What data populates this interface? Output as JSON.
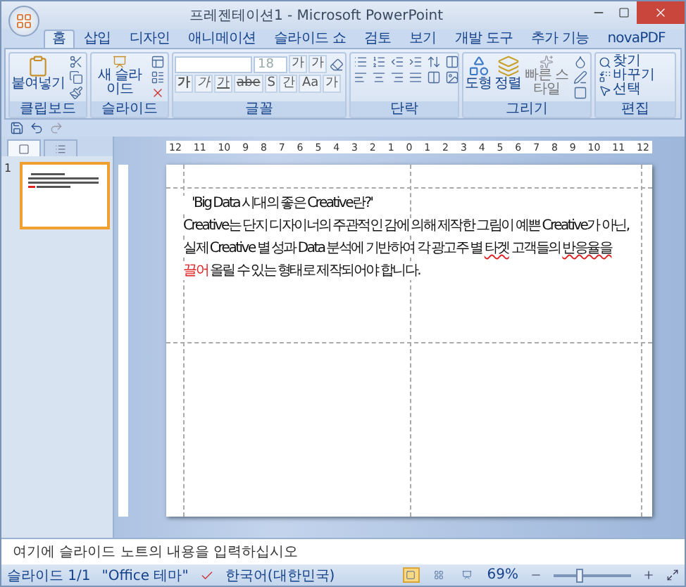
{
  "window": {
    "title": "프레젠테이션1 - Microsoft PowerPoint"
  },
  "tabs": [
    {
      "label": "홈",
      "selected": true
    },
    {
      "label": "삽입",
      "selected": false
    },
    {
      "label": "디자인",
      "selected": false
    },
    {
      "label": "애니메이션",
      "selected": false
    },
    {
      "label": "슬라이드 쇼",
      "selected": false
    },
    {
      "label": "검토",
      "selected": false
    },
    {
      "label": "보기",
      "selected": false
    },
    {
      "label": "개발 도구",
      "selected": false
    },
    {
      "label": "추가 기능",
      "selected": false
    },
    {
      "label": "novaPDF",
      "selected": false
    }
  ],
  "ribbon": {
    "groups": [
      {
        "kind": "clipboard",
        "label": "클립보드",
        "buttons": [
          "붙여넣기"
        ]
      },
      {
        "kind": "slides",
        "label": "슬라이드",
        "buttons": [
          "새 슬라이드"
        ]
      },
      {
        "kind": "font",
        "label": "글꼴",
        "size": "18",
        "grow": [
          "가",
          "가"
        ],
        "styles": [
          "가",
          "가",
          "가",
          "abe",
          "S",
          "간",
          "Aa",
          "가"
        ]
      },
      {
        "kind": "paragraph",
        "label": "단락"
      },
      {
        "kind": "drawing",
        "label": "그리기",
        "buttons": [
          "도형",
          "정렬",
          "빠른 스타일"
        ]
      },
      {
        "kind": "editing",
        "label": "편집",
        "buttons": [
          "찾기",
          "바꾸기",
          "선택"
        ]
      }
    ]
  },
  "thumbnail_pane": {
    "tabs": [
      {
        "selected": true
      },
      {
        "selected": false
      }
    ],
    "slides": [
      {
        "number": "1",
        "selected": true
      }
    ]
  },
  "ruler": [
    "12",
    "11",
    "10",
    "9",
    "8",
    "7",
    "6",
    "5",
    "4",
    "3",
    "2",
    "1",
    "0",
    "1",
    "2",
    "3",
    "4",
    "5",
    "6",
    "7",
    "8",
    "9",
    "10",
    "11",
    "12"
  ],
  "slide": {
    "lines": [
      {
        "indent": true,
        "segments": [
          {
            "kind": "plain",
            "text": "'Big Data 시대의 좋은 Creative란?'"
          }
        ]
      },
      {
        "indent": false,
        "segments": [
          {
            "kind": "plain",
            "text": "Creative는 단지 디자이너의 주관적인 감에 의해 제작한 그림이 예쁜 Creative가 아닌,"
          }
        ]
      },
      {
        "indent": false,
        "segments": [
          {
            "kind": "plain",
            "text": "실제 Creative 별 성과 Data 분석에 기반하여 각 광고주 별 "
          },
          {
            "kind": "misspelled",
            "text": "타겟"
          },
          {
            "kind": "plain",
            "text": " 고객들의 "
          },
          {
            "kind": "misspelled",
            "text": "반응율을"
          }
        ]
      },
      {
        "indent": false,
        "segments": [
          {
            "kind": "red",
            "text": "끌어"
          },
          {
            "kind": "plain",
            "text": " 올릴 수 있는 형태로 제작되어야 합니다."
          }
        ]
      }
    ]
  },
  "notes": {
    "text": "여기에 슬라이드 노트의 내용을 입력하십시오"
  },
  "status_bar": {
    "items": [
      "슬라이드 1/1",
      "\"Office 테마\"",
      "한국어(대한민국)"
    ],
    "views": [
      {
        "selected": true
      },
      {
        "selected": false
      },
      {
        "selected": false
      }
    ],
    "zoom": "69%",
    "zoom_level": {
      "level": 0.32
    }
  }
}
